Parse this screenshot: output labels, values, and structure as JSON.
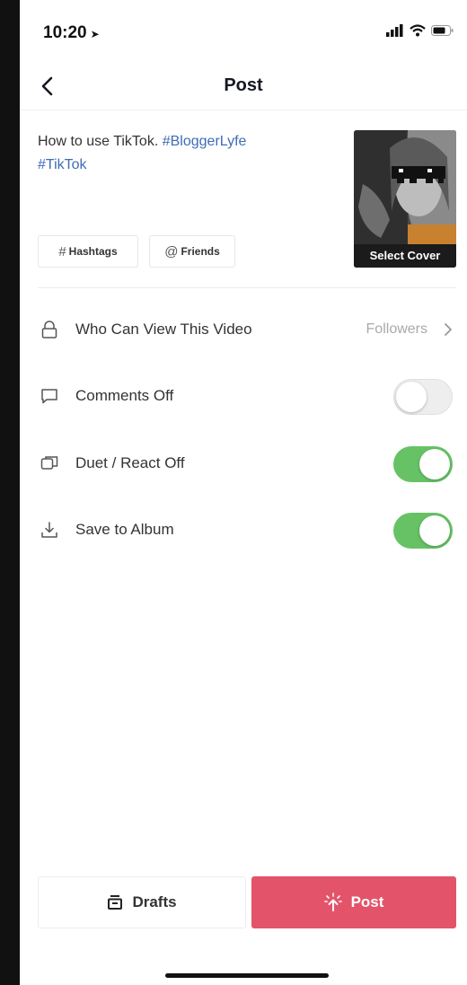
{
  "status_bar": {
    "time": "10:20",
    "location_glyph": "➤"
  },
  "header": {
    "title": "Post"
  },
  "caption": {
    "text": "How to use TikTok. ",
    "hashtag_1": "#BloggerLyfe",
    "hashtag_2": "#TikTok"
  },
  "chips": {
    "hashtags_label": "Hashtags",
    "friends_label": "Friends"
  },
  "cover": {
    "label": "Select Cover"
  },
  "settings": {
    "who_can_view": {
      "label": "Who Can View This Video",
      "value": "Followers"
    },
    "comments": {
      "label": "Comments Off",
      "on": false
    },
    "duet": {
      "label": "Duet / React Off",
      "on": true
    },
    "save": {
      "label": "Save to Album",
      "on": true
    }
  },
  "actions": {
    "drafts_label": "Drafts",
    "post_label": "Post"
  },
  "colors": {
    "toggle_on": "#67c266",
    "post_button": "#e3546a",
    "hashtag": "#3f6cb5"
  },
  "icons": {
    "back": "chevron-left-icon",
    "lock": "lock-icon",
    "comment": "comment-icon",
    "duet": "duet-icon",
    "download": "download-icon",
    "drafts": "drafts-box-icon",
    "post": "upload-sparkle-icon"
  }
}
